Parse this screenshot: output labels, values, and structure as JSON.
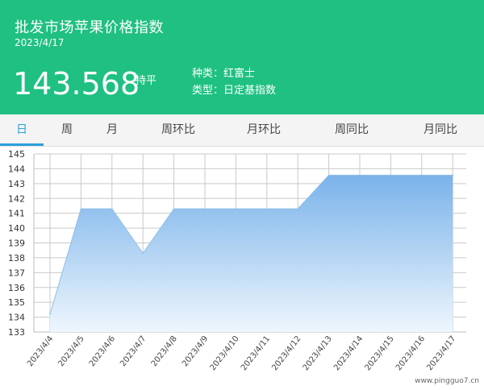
{
  "header": {
    "title": "批发市场苹果价格指数",
    "date": "2023/4/17",
    "value": "143.568",
    "trend_label": "持平",
    "variety": "种类：红富士",
    "type": "类型：日定基指数"
  },
  "tabs": [
    {
      "label": "日",
      "active": true
    },
    {
      "label": "周",
      "active": false
    },
    {
      "label": "月",
      "active": false
    },
    {
      "label": "周环比",
      "active": false
    },
    {
      "label": "月环比",
      "active": false
    },
    {
      "label": "周同比",
      "active": false
    },
    {
      "label": "月同比",
      "active": false
    }
  ],
  "chart_data": {
    "type": "area",
    "title": "",
    "xlabel": "",
    "ylabel": "",
    "categories": [
      "2023/4/4",
      "2023/4/5",
      "2023/4/6",
      "2023/4/7",
      "2023/4/8",
      "2023/4/9",
      "2023/4/10",
      "2023/4/11",
      "2023/4/12",
      "2023/4/13",
      "2023/4/14",
      "2023/4/15",
      "2023/4/16",
      "2023/4/17"
    ],
    "series": [
      {
        "values": [
          134.2,
          141.3,
          141.3,
          138.3,
          141.3,
          141.3,
          141.3,
          141.3,
          141.3,
          143.568,
          143.568,
          143.568,
          143.568,
          143.568
        ]
      }
    ],
    "ylim": [
      133,
      145
    ],
    "yticks": [
      133,
      134,
      135,
      136,
      137,
      138,
      139,
      140,
      141,
      142,
      143,
      144,
      145
    ],
    "grid": true,
    "colors": {
      "line": "#8ebfe8",
      "fill_top": "#7ab3ea",
      "fill_bottom": "#eef6fd",
      "grid": "#c9c9c9"
    }
  },
  "watermark": "www.pingguo7.cn"
}
